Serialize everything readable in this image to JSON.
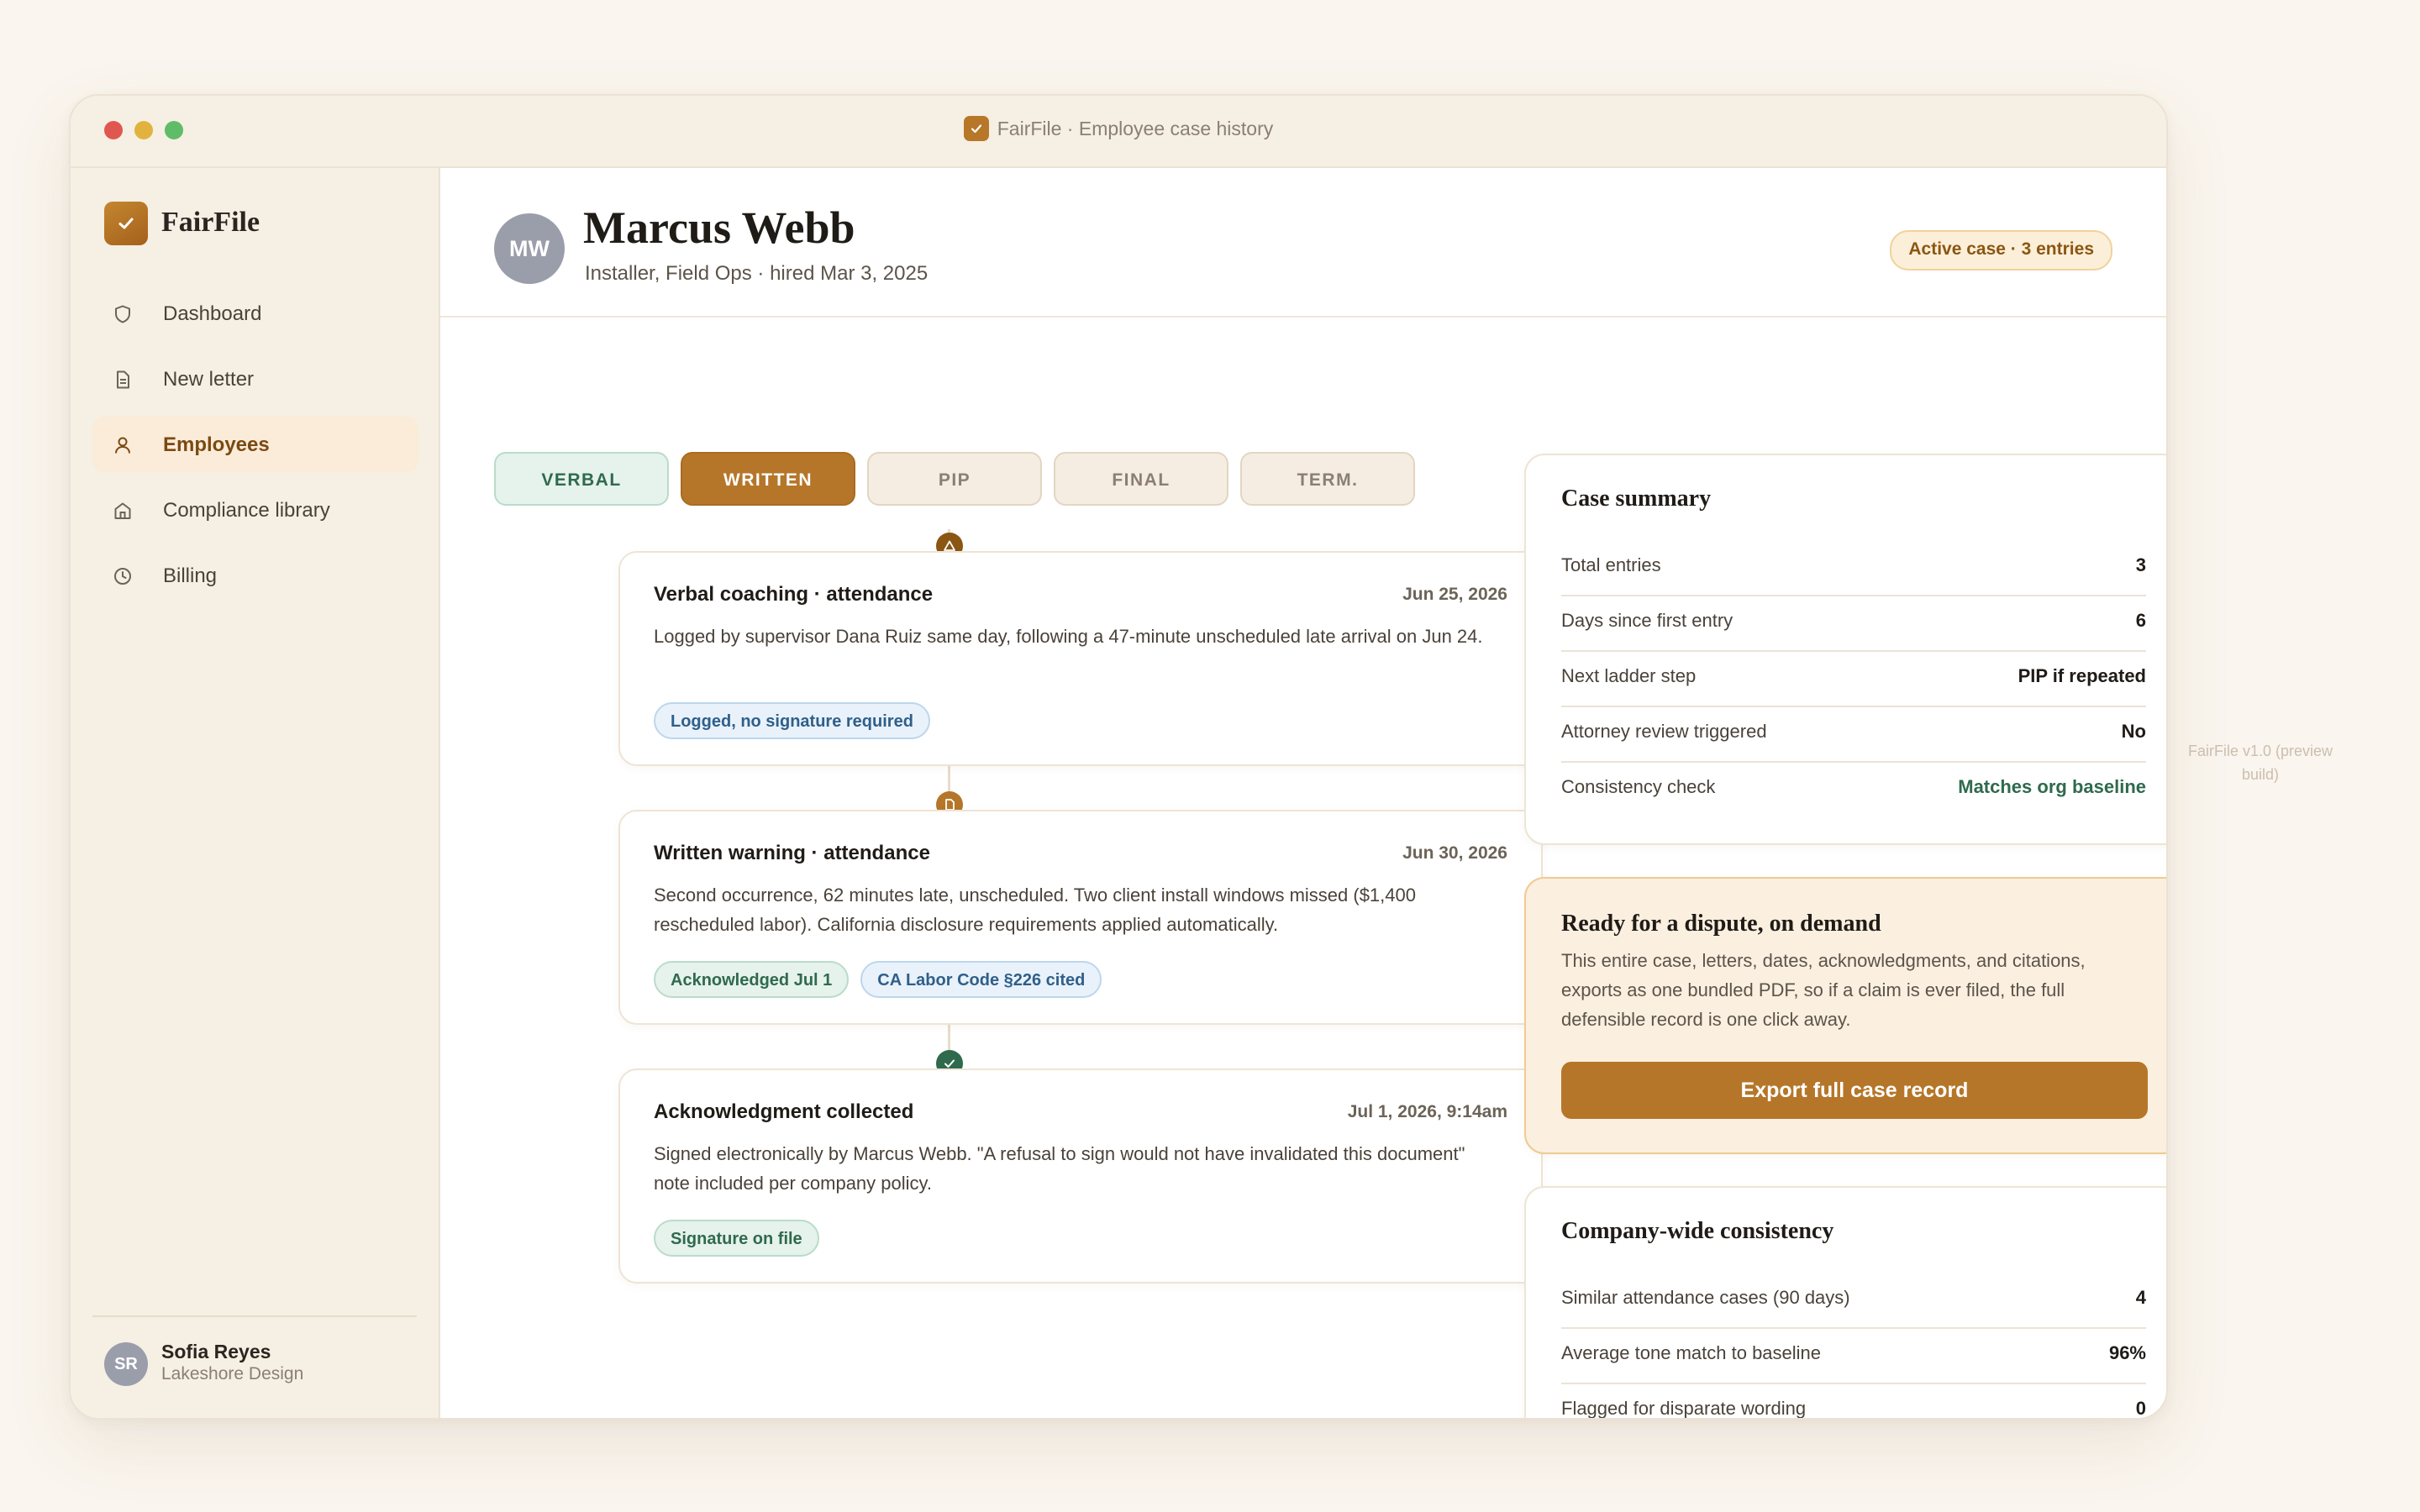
{
  "window": {
    "title": "FairFile · Employee case history"
  },
  "sidebar": {
    "brand": "FairFile",
    "items": [
      {
        "label": "Dashboard",
        "icon": "shield-icon",
        "active": false
      },
      {
        "label": "New letter",
        "icon": "document-icon",
        "active": false
      },
      {
        "label": "Employees",
        "icon": "person-icon",
        "active": true
      },
      {
        "label": "Compliance library",
        "icon": "library-icon",
        "active": false
      },
      {
        "label": "Billing",
        "icon": "clock-icon",
        "active": false
      }
    ],
    "user": {
      "initials": "SR",
      "name": "Sofia Reyes",
      "org": "Lakeshore Design"
    }
  },
  "employee": {
    "initials": "MW",
    "name": "Marcus Webb",
    "subtitle": "Installer, Field Ops · hired Mar 3, 2025",
    "status_badge": "Active case · 3 entries"
  },
  "ladder": {
    "steps": [
      {
        "label": "VERBAL",
        "state": "done"
      },
      {
        "label": "WRITTEN",
        "state": "current"
      },
      {
        "label": "PIP",
        "state": "future"
      },
      {
        "label": "FINAL",
        "state": "future"
      },
      {
        "label": "TERM.",
        "state": "future"
      }
    ]
  },
  "timeline": [
    {
      "icon": "warning-triangle-icon",
      "title": "Verbal coaching · attendance",
      "date": "Jun 25, 2026",
      "description": "Logged by supervisor Dana Ruiz same day, following a 47-minute unscheduled late arrival on Jun 24.",
      "tags": [
        {
          "label": "Logged, no signature required",
          "color": "blue"
        }
      ]
    },
    {
      "icon": "document-icon",
      "title": "Written warning · attendance",
      "date": "Jun 30, 2026",
      "description": "Second occurrence, 62 minutes late, unscheduled. Two client install windows missed ($1,400 rescheduled labor). California disclosure requirements applied automatically.",
      "tags": [
        {
          "label": "Acknowledged Jul 1",
          "color": "green"
        },
        {
          "label": "CA Labor Code §226 cited",
          "color": "blue"
        }
      ]
    },
    {
      "icon": "check-circle-icon",
      "title": "Acknowledgment collected",
      "date": "Jul 1, 2026, 9:14am",
      "description": "Signed electronically by Marcus Webb. \"A refusal to sign would not have invalidated this document\" note included per company policy.",
      "tags": [
        {
          "label": "Signature on file",
          "color": "green"
        }
      ]
    }
  ],
  "case_summary": {
    "title": "Case summary",
    "rows": [
      {
        "label": "Total entries",
        "value": "3"
      },
      {
        "label": "Days since first entry",
        "value": "6"
      },
      {
        "label": "Next ladder step",
        "value": "PIP if repeated"
      },
      {
        "label": "Attorney review triggered",
        "value": "No"
      },
      {
        "label": "Consistency check",
        "value": "Matches org baseline"
      }
    ]
  },
  "dispute": {
    "title": "Ready for a dispute, on demand",
    "text": "This entire case, letters, dates, acknowledgments, and citations, exports as one bundled PDF, so if a claim is ever filed, the full defensible record is one click away.",
    "button": "Export full case record"
  },
  "consistency": {
    "title": "Company-wide consistency",
    "rows": [
      {
        "label": "Similar attendance cases (90 days)",
        "value": "4"
      },
      {
        "label": "Average tone match to baseline",
        "value": "96%"
      },
      {
        "label": "Flagged for disparate wording",
        "value": "0"
      }
    ]
  },
  "version_note": "FairFile v1.0 (preview build)",
  "colors": {
    "accent": "#b5762a",
    "success": "#2f6a4d",
    "background": "#faf5ee",
    "sidebar": "#f6efe3"
  }
}
